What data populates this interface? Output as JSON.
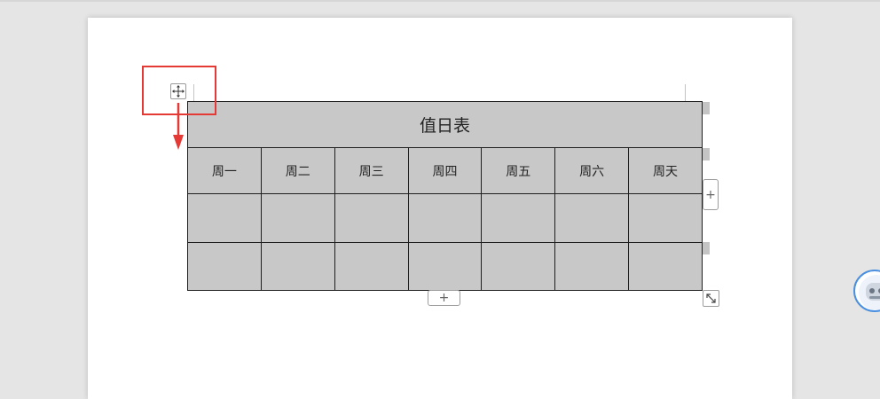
{
  "table": {
    "title": "值日表",
    "days": [
      "周一",
      "周二",
      "周三",
      "周四",
      "周五",
      "周六",
      "周天"
    ],
    "empty_rows": 2
  },
  "controls": {
    "add_row_symbol": "+",
    "add_column_symbol": "+"
  },
  "icons": {
    "move": "move-icon",
    "resize": "resize-icon",
    "assistant": "assistant-avatar-icon"
  },
  "colors": {
    "highlight": "#e53935",
    "table_fill": "#c8c8c8",
    "avatar_ring": "#4a8fe0"
  }
}
